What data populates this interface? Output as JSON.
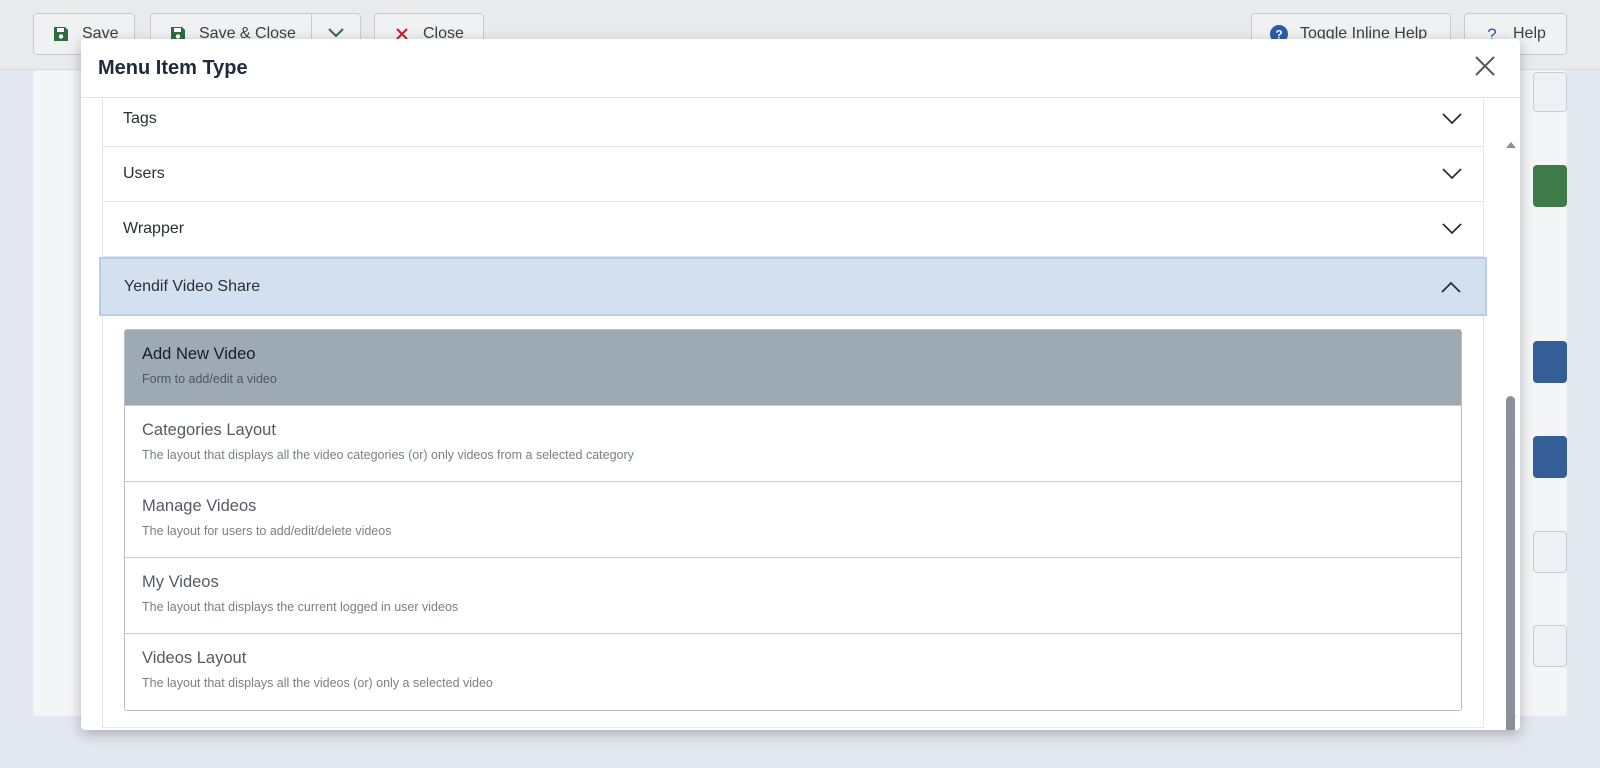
{
  "toolbar": {
    "save_label": "Save",
    "save_close_label": "Save & Close",
    "close_label": "Close",
    "inline_help_label": "Toggle Inline Help",
    "help_label": "Help"
  },
  "modal": {
    "title": "Menu Item Type",
    "categories": [
      {
        "label": "Tags",
        "expanded": false
      },
      {
        "label": "Users",
        "expanded": false
      },
      {
        "label": "Wrapper",
        "expanded": false
      },
      {
        "label": "Yendif Video Share",
        "expanded": true
      }
    ],
    "items": [
      {
        "name": "Add New Video",
        "desc": "Form to add/edit a video",
        "selected": true
      },
      {
        "name": "Categories Layout",
        "desc": "The layout that displays all the video categories (or) only videos from a selected category",
        "selected": false
      },
      {
        "name": "Manage Videos",
        "desc": "The layout for users to add/edit/delete videos",
        "selected": false
      },
      {
        "name": "My Videos",
        "desc": "The layout that displays the current logged in user videos",
        "selected": false
      },
      {
        "name": "Videos Layout",
        "desc": "The layout that displays all the videos (or) only a selected video",
        "selected": false
      }
    ]
  },
  "colors": {
    "accent_green": "#2f6b3f",
    "accent_red": "#c0262d",
    "accent_blue": "#2a5ca8",
    "active_category_bg": "#d3e0f0",
    "selected_item_bg": "#9ea9b6"
  },
  "icons": {
    "save": "floppy-disk-icon",
    "close": "x-icon",
    "dropdown": "chevron-down-icon",
    "help": "question-circle-icon",
    "modal_close": "close-icon",
    "collapsed": "chevron-down-icon",
    "expanded": "chevron-up-icon"
  }
}
